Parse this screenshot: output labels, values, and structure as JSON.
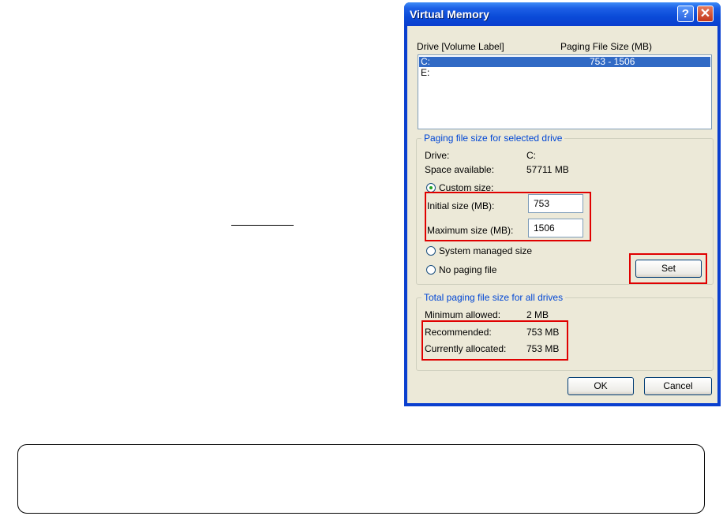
{
  "dialog": {
    "title": "Virtual Memory",
    "help_glyph": "?",
    "close_glyph": "✕",
    "drive_header": "Drive  [Volume Label]",
    "size_header": "Paging File Size (MB)",
    "drives": [
      {
        "drive": "C:",
        "size": "753 - 1506",
        "selected": true
      },
      {
        "drive": "E:",
        "size": "",
        "selected": false
      }
    ],
    "selected_group": {
      "title": "Paging file size for selected drive",
      "drive_label": "Drive:",
      "drive_value": "C:",
      "space_label": "Space available:",
      "space_value": "57711 MB",
      "custom_label": "Custom size:",
      "initial_label": "Initial size (MB):",
      "initial_value": "753",
      "max_label": "Maximum size (MB):",
      "max_value": "1506",
      "system_label": "System managed size",
      "nopage_label": "No paging file",
      "set_label": "Set"
    },
    "total_group": {
      "title": "Total paging file size for all drives",
      "min_label": "Minimum allowed:",
      "min_value": "2 MB",
      "rec_label": "Recommended:",
      "rec_value": "753 MB",
      "cur_label": "Currently allocated:",
      "cur_value": "753 MB"
    },
    "ok_label": "OK",
    "cancel_label": "Cancel"
  },
  "caption": "",
  "colors": {
    "highlight": "#e00000",
    "selection": "#316ac5",
    "titlebar": "#0a4bd8"
  }
}
